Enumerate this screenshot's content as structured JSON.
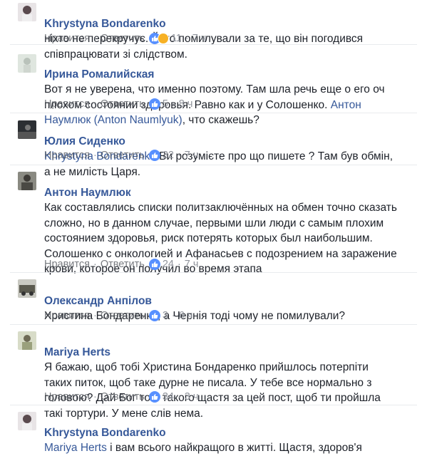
{
  "actions": {
    "like": "Нравится",
    "reply": "Ответить"
  },
  "comments": [
    {
      "author": "Khrystyna Bondarenko",
      "mention": "",
      "text": "ніхто не перекручує. Його помилували за те, що він погодився співпрацювати зі слідством.",
      "text_after": "",
      "reactions": "11",
      "time": "7 ч"
    },
    {
      "author": "Ирина Ромалийская",
      "mention": "Антон Наумлюк (Anton Naumlyuk)",
      "text": "Вот я не уверена, что именно поэтому. Там шла речь еще о его оч плохом состоянии здоровья. Равно как и у Солошенко. ",
      "text_after": ", что скажешь?",
      "reactions": "5",
      "time": "8 ч"
    },
    {
      "author": "Юлия Сиденко",
      "mention": "Khrystyna Bondarenko",
      "text": "",
      "text_after": " Ви розумієте про що пишете ? Там був обмін, а не милість Царя.",
      "reactions": "32",
      "time": "7 ч"
    },
    {
      "author": "Антон Наумлюк",
      "mention": "",
      "text": "Как составлялись списки политзаключённых на обмен точно сказать сложно, но в данном случае, первыми шли люди с самым плохим состоянием здоровья, риск потерять которых был наибольшим. Солошенко с онкологией и Афанасьев с подозрением на заражение крови, которое он получил во время этапа",
      "text_after": "",
      "reactions": "24",
      "time": "7 ч"
    },
    {
      "author": "Олександр Анпілов",
      "mention": "",
      "text": "Христина Бондаренко, а Чернія тоді чому не помилували?",
      "text_after": "",
      "reactions": "3",
      "time": "6 ч"
    },
    {
      "author": "Mariya Herts",
      "mention": "",
      "text": "Я бажаю, щоб тобі Христина Бондаренко прийшлось потерпіти таких питок, щоб таке дурне не писала. У тебе все нормально з головою? Дай Бог тобі такого щастя за цей пост, щоб ти пройшла такі тортури. У мене слів нема.",
      "text_after": "",
      "reactions": "34",
      "time": "3 ч"
    },
    {
      "author": "Khrystyna Bondarenko",
      "mention": "Mariya Herts",
      "text": "",
      "text_after": " і вам всього найкращого в житті. Щастя, здоров'я",
      "reactions": "",
      "time": ""
    }
  ],
  "colors": {
    "link": "#365899",
    "meta": "#90949c",
    "like_badge": "#5890ff"
  }
}
